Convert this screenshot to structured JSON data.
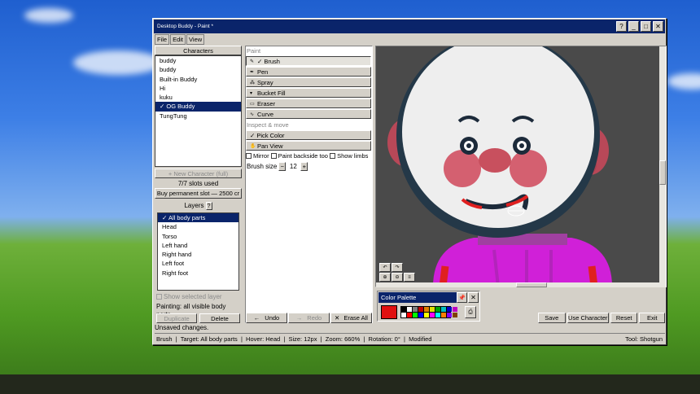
{
  "window": {
    "title": "Desktop Buddy - Paint *",
    "buttons": [
      "?",
      "_",
      "□",
      "✕"
    ]
  },
  "menu": [
    "File",
    "Edit",
    "View"
  ],
  "characters": {
    "header": "Characters",
    "items": [
      {
        "label": "buddy",
        "selected": false
      },
      {
        "label": "buddy",
        "selected": false
      },
      {
        "label": "Built-in Buddy",
        "selected": false
      },
      {
        "label": "Hi",
        "selected": false
      },
      {
        "label": "kuku",
        "selected": false
      },
      {
        "label": "✓ OG Buddy",
        "selected": true
      },
      {
        "label": "TungTung",
        "selected": false
      }
    ],
    "new_button": "+ New Character (full)",
    "slots": "7/7 slots used",
    "buy_button": "Buy permanent slot — 2500 cr"
  },
  "layers": {
    "header": "Layers",
    "help": "?",
    "items": [
      {
        "label": "✓ All body parts",
        "selected": true
      },
      {
        "label": "Head",
        "selected": false
      },
      {
        "label": "Torso",
        "selected": false
      },
      {
        "label": "Left hand",
        "selected": false
      },
      {
        "label": "Right hand",
        "selected": false
      },
      {
        "label": "Left foot",
        "selected": false
      },
      {
        "label": "Right foot",
        "selected": false
      }
    ],
    "show_selected": "Show selected layer",
    "painting": "Painting: all visible body parts",
    "duplicate": "Duplicate",
    "delete": "Delete"
  },
  "paint": {
    "section": "Paint",
    "tools": [
      {
        "label": "✓ Brush",
        "icon": "brush-icon",
        "active": true
      },
      {
        "label": "Pen",
        "icon": "pen-icon",
        "active": false
      },
      {
        "label": "Spray",
        "icon": "spray-icon",
        "active": false
      },
      {
        "label": "Bucket Fill",
        "icon": "bucket-icon",
        "active": false
      },
      {
        "label": "Eraser",
        "icon": "eraser-icon",
        "active": false
      },
      {
        "label": "Curve",
        "icon": "curve-icon",
        "active": false
      }
    ],
    "inspect_section": "Inspect & move",
    "inspect_tools": [
      {
        "label": "✓ Pick Color",
        "icon": "picker-icon",
        "active": false
      },
      {
        "label": "Pan View",
        "icon": "hand-icon",
        "active": false
      }
    ],
    "mirror": "Mirror",
    "backside": "Paint backside too",
    "limbs": "Show limbs",
    "brush_size_label": "Brush size",
    "brush_minus": "−",
    "brush_size": "12",
    "brush_plus": "+",
    "undo": "Undo",
    "redo": "Redo",
    "erase_all": "Erase All"
  },
  "palette": {
    "title": "Color Palette",
    "current_color": "#e01010",
    "swatches": [
      "#000000",
      "#ffffff",
      "#808080",
      "#c00000",
      "#e08000",
      "#e0e000",
      "#00a000",
      "#00c0c0",
      "#0000c0",
      "#c000c0",
      "#ffffff",
      "#ff0000",
      "#00ff00",
      "#0000ff",
      "#ffff00",
      "#ff00ff",
      "#00ffff",
      "#ff8000",
      "#8000ff",
      "#804000"
    ]
  },
  "actions": {
    "save": "Save",
    "use_character": "Use Character",
    "reset": "Reset",
    "exit": "Exit"
  },
  "notice": "Unsaved changes.",
  "statusbar": {
    "text": "Brush  |  Target: All body parts  |  Hover: Head  |  Size: 12px  |  Zoom: 660%  |  Rotation: 0°  |  Modified",
    "tool": "Tool: Shotgun"
  },
  "colors": {
    "titlebar": "#0a246a",
    "canvas_bg": "#4a4a4a",
    "head": "#ececec",
    "nose": "#c8505e",
    "shirt": "#d020d8"
  }
}
